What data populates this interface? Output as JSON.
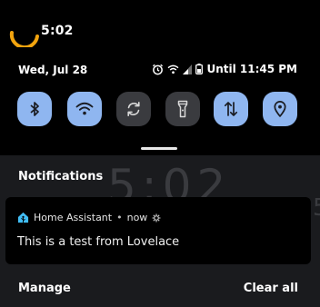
{
  "status_bar": {
    "time": "5:02",
    "date": "Wed, Jul 28",
    "alarm_text": "Until 11:45 PM"
  },
  "quick_settings": {
    "tiles": [
      {
        "name": "bluetooth",
        "icon": "bluetooth-icon",
        "state": "on"
      },
      {
        "name": "wifi",
        "icon": "wifi-icon",
        "state": "on"
      },
      {
        "name": "auto-rotate",
        "icon": "rotate-icon",
        "state": "off"
      },
      {
        "name": "flashlight",
        "icon": "flashlight-icon",
        "state": "off"
      },
      {
        "name": "mobile-data",
        "icon": "data-arrows-icon",
        "state": "on"
      },
      {
        "name": "location",
        "icon": "location-icon",
        "state": "on"
      }
    ],
    "active_color": "#8fb6f0",
    "inactive_color": "#3a3b3f"
  },
  "background_clock": "5:02",
  "notifications": {
    "header": "Notifications",
    "items": [
      {
        "app": "Home Assistant",
        "separator": "•",
        "when": "now",
        "message": "This is a test from Lovelace"
      }
    ],
    "manage_label": "Manage",
    "clear_all_label": "Clear all"
  }
}
